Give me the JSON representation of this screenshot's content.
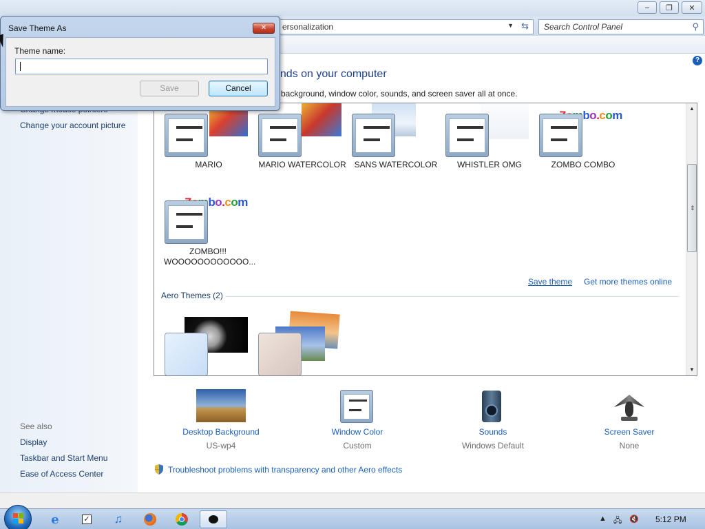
{
  "window": {
    "address_crumb": "ersonalization",
    "search_placeholder": "Search Control Panel",
    "caption_minimize": "–",
    "caption_restore": "❐",
    "caption_close": "✕"
  },
  "left_pane": {
    "links_top": [
      "Change mouse pointers",
      "Change your account picture"
    ],
    "see_also_heading": "See also",
    "see_also_links": [
      "Display",
      "Taskbar and Start Menu",
      "Ease of Access Center"
    ]
  },
  "content": {
    "heading": "unds on your computer",
    "subheading": "p background, window color, sounds, and screen saver all at once.",
    "help_glyph": "?",
    "themes": [
      {
        "label": "MARIO"
      },
      {
        "label": "MARIO WATERCOLOR"
      },
      {
        "label": "SANS WATERCOLOR"
      },
      {
        "label": "WHISTLER OMG"
      },
      {
        "label": "ZOMBO COMBO"
      },
      {
        "label": "ZOMBO!!! WOOOOOOOOOOOO..."
      }
    ],
    "zombo_text": "Zombo.com",
    "save_theme_link": "Save theme",
    "get_more_link": "Get more themes online",
    "aero_heading": "Aero Themes (2)"
  },
  "bottom": {
    "items": [
      {
        "label": "Desktop Background",
        "value": "US-wp4",
        "icon": "landscape-icon"
      },
      {
        "label": "Window Color",
        "value": "Custom",
        "icon": "window-color-icon"
      },
      {
        "label": "Sounds",
        "value": "Windows Default",
        "icon": "speaker-icon"
      },
      {
        "label": "Screen Saver",
        "value": "None",
        "icon": "screen-saver-icon"
      }
    ],
    "troubleshoot_link": "Troubleshoot problems with transparency and other Aero effects"
  },
  "dialog": {
    "title": "Save Theme As",
    "close_glyph": "✕",
    "field_label": "Theme name:",
    "field_value": "",
    "save_label": "Save",
    "cancel_label": "Cancel"
  },
  "taskbar": {
    "clock": "5:12 PM",
    "apps": [
      "internet-explorer-icon",
      "task-icon",
      "itunes-icon",
      "firefox-icon",
      "chrome-icon",
      "active-app-icon"
    ]
  },
  "colors": {
    "link": "#1c5fb8",
    "heading": "#1e3f8a",
    "left_pane": "#e9f0f8",
    "taskbar": "#bcd3ec"
  }
}
